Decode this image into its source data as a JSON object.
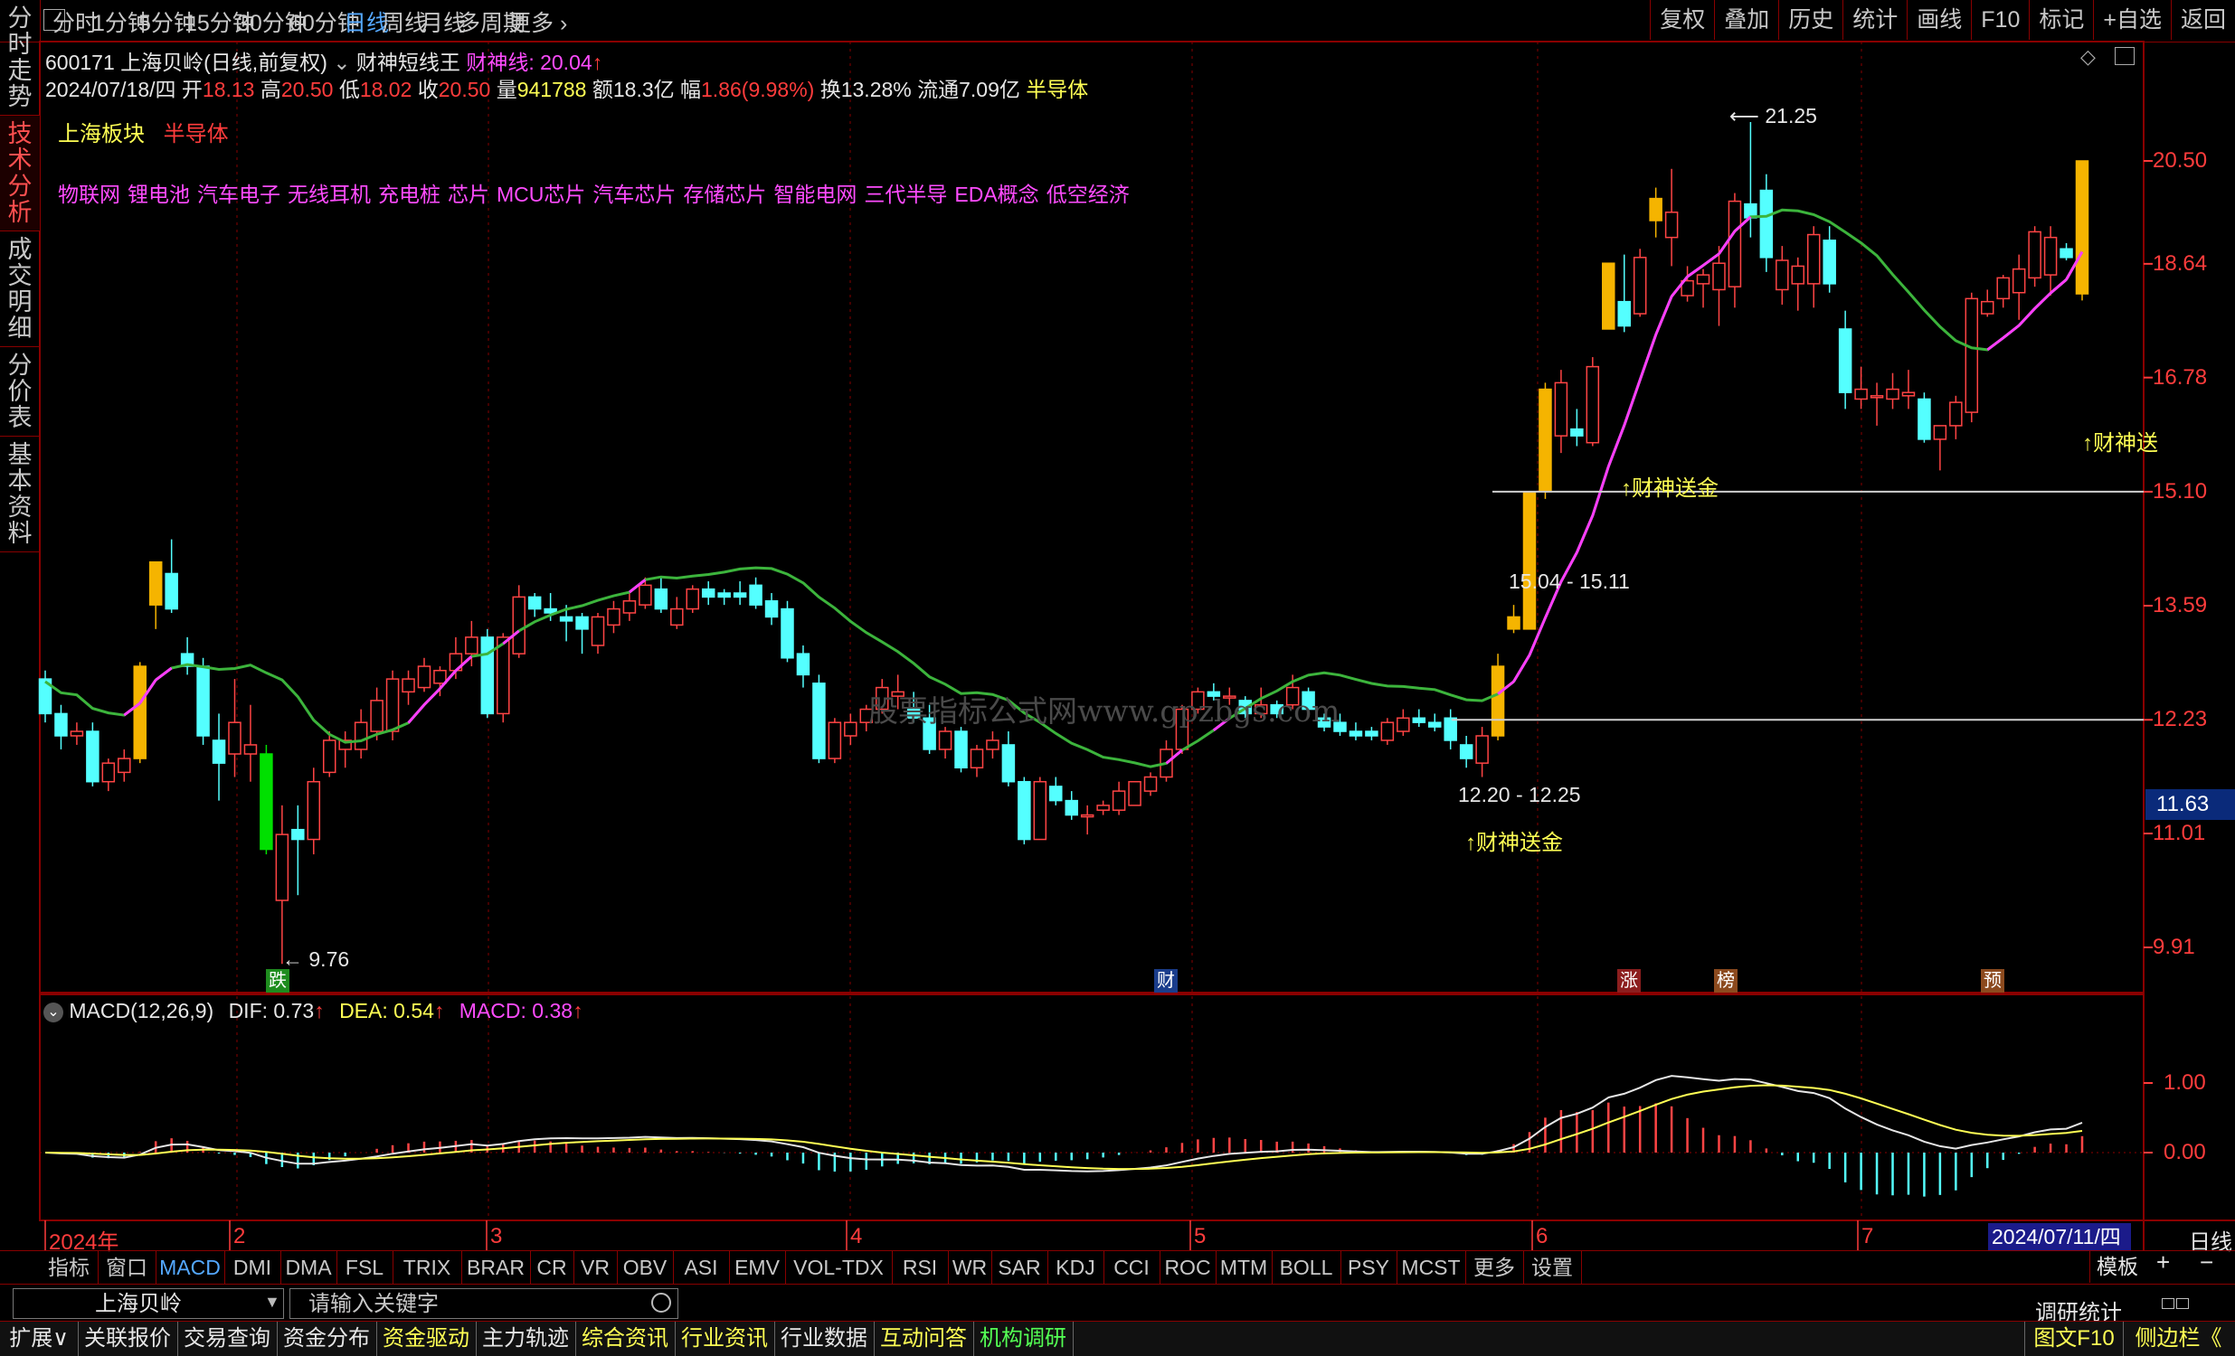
{
  "top_tabs": [
    "分时",
    "1分钟",
    "5分钟",
    "15分钟",
    "30分钟",
    "60分钟",
    "日线",
    "周线",
    "月线",
    "多周期",
    "更多"
  ],
  "active_top_tab": "日线",
  "top_right_buttons": [
    "复权",
    "叠加",
    "历史",
    "统计",
    "画线",
    "F10",
    "标记",
    "+自选",
    "返回"
  ],
  "left_tabs": [
    "分时走势",
    "技术分析",
    "成交明细",
    "分价表",
    "基本资料"
  ],
  "active_left_tab": "技术分析",
  "stock_header": {
    "code_name": "600171 上海贝岭(日线,前复权)",
    "indicator": "财神短线王",
    "line_label": "财神线:",
    "line_value": "20.04",
    "arrow": "↑"
  },
  "quote": {
    "date": "2024/07/18/四",
    "open_label": "开",
    "open": "18.13",
    "high_label": "高",
    "high": "20.50",
    "low_label": "低",
    "low": "18.02",
    "close_label": "收",
    "close": "20.50",
    "vol_label": "量",
    "vol": "941788",
    "amount": "额18.3亿",
    "change_label": "幅",
    "change": "1.86(9.98%)",
    "turnover": "换13.28%",
    "float": "流通7.09亿",
    "sector": "半导体"
  },
  "board": {
    "label": "上海板块",
    "sector": "半导体"
  },
  "concepts": [
    "物联网",
    "锂电池",
    "汽车电子",
    "无线耳机",
    "充电桩",
    "芯片",
    "MCU芯片",
    "汽车芯片",
    "存储芯片",
    "智能电网",
    "三代半导",
    "EDA概念",
    "低空经济"
  ],
  "watermark": "股票指标公式网www.gpzbgs.com",
  "price_ticks": [
    "20.50",
    "18.64",
    "16.78",
    "15.10",
    "13.59",
    "12.23",
    "11.01",
    "9.91"
  ],
  "current_price": "11.63",
  "annotations": {
    "high_label": "21.25",
    "low_label": "9.76",
    "zone_upper": "15.04 - 15.11",
    "zone_lower": "12.20 - 12.25",
    "signal_1": "↑财神送金",
    "signal_2": "↑财神送金",
    "signal_3": "↑财神送"
  },
  "event_markers": [
    {
      "text": "跌",
      "color": "#1e8c1e"
    },
    {
      "text": "财",
      "color": "#1a3d8c"
    },
    {
      "text": "涨",
      "color": "#8c1e1e"
    },
    {
      "text": "榜",
      "color": "#8c4a1e"
    },
    {
      "text": "预",
      "color": "#8c4a1e"
    }
  ],
  "macd_header": {
    "name": "MACD(12,26,9)",
    "dif": "DIF: 0.73",
    "dea": "DEA: 0.54",
    "macd": "MACD: 0.38",
    "arrow": "↑"
  },
  "macd_ticks": [
    "1.00",
    "0.00"
  ],
  "date_axis": [
    "2024年",
    "2",
    "3",
    "4",
    "5",
    "6",
    "7"
  ],
  "current_date": "2024/07/11/四",
  "period_label": "日线",
  "indicator_tabs": [
    "指标",
    "窗口",
    "MACD",
    "DMI",
    "DMA",
    "FSL",
    "TRIX",
    "BRAR",
    "CR",
    "VR",
    "OBV",
    "ASI",
    "EMV",
    "VOL-TDX",
    "RSI",
    "WR",
    "SAR",
    "KDJ",
    "CCI",
    "ROC",
    "MTM",
    "BOLL",
    "PSY",
    "MCST",
    "更多",
    "设置"
  ],
  "active_indicator_tab": "MACD",
  "template_label": "模板",
  "search": {
    "stock_name": "上海贝岭",
    "placeholder": "请输入关键字"
  },
  "research_label": "调研统计",
  "bottom_tabs": [
    "扩展∨",
    "关联报价",
    "交易查询",
    "资金分布",
    "资金驱动",
    "主力轨迹",
    "综合资讯",
    "行业资讯",
    "行业数据",
    "互动问答",
    "机构调研"
  ],
  "bottom_right": [
    "图文F10",
    "侧边栏《"
  ],
  "chart_data": {
    "type": "candlestick",
    "series": [
      {
        "d": "2024-01-02",
        "o": 12.7,
        "h": 12.8,
        "l": 12.2,
        "c": 12.3
      },
      {
        "d": "2024-01-03",
        "o": 12.3,
        "h": 12.4,
        "l": 11.9,
        "c": 12.05
      },
      {
        "d": "2024-01-04",
        "o": 12.05,
        "h": 12.2,
        "l": 11.95,
        "c": 12.1
      },
      {
        "d": "2024-01-05",
        "o": 12.1,
        "h": 12.2,
        "l": 11.5,
        "c": 11.55
      },
      {
        "d": "2024-01-08",
        "o": 11.55,
        "h": 11.8,
        "l": 11.45,
        "c": 11.75
      },
      {
        "d": "2024-01-09",
        "o": 11.65,
        "h": 11.9,
        "l": 11.55,
        "c": 11.8
      },
      {
        "d": "2024-01-10",
        "o": 11.8,
        "h": 12.9,
        "l": 11.75,
        "c": 12.85
      },
      {
        "d": "2024-01-11",
        "o": 13.6,
        "h": 14.15,
        "l": 13.3,
        "c": 14.15
      },
      {
        "d": "2024-01-12",
        "o": 14.0,
        "h": 14.45,
        "l": 13.5,
        "c": 13.55
      },
      {
        "d": "2024-01-15",
        "o": 13.0,
        "h": 13.2,
        "l": 12.75,
        "c": 12.85
      },
      {
        "d": "2024-01-16",
        "o": 12.85,
        "h": 12.95,
        "l": 11.95,
        "c": 12.05
      },
      {
        "d": "2024-01-17",
        "o": 12.0,
        "h": 12.3,
        "l": 11.35,
        "c": 11.75
      },
      {
        "d": "2024-01-18",
        "o": 11.85,
        "h": 12.7,
        "l": 11.6,
        "c": 12.2
      },
      {
        "d": "2024-01-19",
        "o": 11.85,
        "h": 12.4,
        "l": 11.55,
        "c": 11.95
      },
      {
        "d": "2024-01-22",
        "o": 11.85,
        "h": 11.95,
        "l": 10.8,
        "c": 10.85
      },
      {
        "d": "2024-02-05",
        "o": 10.35,
        "h": 11.3,
        "l": 9.76,
        "c": 11.0
      },
      {
        "d": "2024-02-06",
        "o": 11.05,
        "h": 11.3,
        "l": 10.4,
        "c": 10.95
      },
      {
        "d": "2024-02-07",
        "o": 10.95,
        "h": 11.7,
        "l": 10.8,
        "c": 11.55
      },
      {
        "d": "2024-02-08",
        "o": 11.65,
        "h": 12.1,
        "l": 11.6,
        "c": 12.0
      },
      {
        "d": "2024-02-19",
        "o": 11.9,
        "h": 12.1,
        "l": 11.7,
        "c": 12.0
      },
      {
        "d": "2024-02-20",
        "o": 11.9,
        "h": 12.35,
        "l": 11.8,
        "c": 12.2
      },
      {
        "d": "2024-02-21",
        "o": 12.1,
        "h": 12.6,
        "l": 12.0,
        "c": 12.45
      },
      {
        "d": "2024-02-22",
        "o": 12.1,
        "h": 12.8,
        "l": 12.0,
        "c": 12.7
      },
      {
        "d": "2024-02-23",
        "o": 12.55,
        "h": 12.8,
        "l": 12.4,
        "c": 12.7
      },
      {
        "d": "2024-02-26",
        "o": 12.6,
        "h": 12.95,
        "l": 12.55,
        "c": 12.85
      },
      {
        "d": "2024-02-27",
        "o": 12.65,
        "h": 12.85,
        "l": 12.5,
        "c": 12.8
      },
      {
        "d": "2024-02-28",
        "o": 12.8,
        "h": 13.2,
        "l": 12.7,
        "c": 13.0
      },
      {
        "d": "2024-02-29",
        "o": 13.0,
        "h": 13.4,
        "l": 12.85,
        "c": 13.2
      },
      {
        "d": "2024-03-01",
        "o": 13.2,
        "h": 13.3,
        "l": 12.25,
        "c": 12.3
      },
      {
        "d": "2024-03-04",
        "o": 12.3,
        "h": 13.25,
        "l": 12.2,
        "c": 13.2
      },
      {
        "d": "2024-03-05",
        "o": 13.0,
        "h": 13.85,
        "l": 12.95,
        "c": 13.7
      },
      {
        "d": "2024-03-06",
        "o": 13.7,
        "h": 13.75,
        "l": 13.45,
        "c": 13.55
      },
      {
        "d": "2024-03-07",
        "o": 13.55,
        "h": 13.75,
        "l": 13.4,
        "c": 13.5
      },
      {
        "d": "2024-03-08",
        "o": 13.45,
        "h": 13.6,
        "l": 13.15,
        "c": 13.4
      },
      {
        "d": "2024-03-11",
        "o": 13.45,
        "h": 13.5,
        "l": 13.0,
        "c": 13.3
      },
      {
        "d": "2024-03-12",
        "o": 13.1,
        "h": 13.5,
        "l": 13.0,
        "c": 13.45
      },
      {
        "d": "2024-03-13",
        "o": 13.35,
        "h": 13.65,
        "l": 13.25,
        "c": 13.55
      },
      {
        "d": "2024-03-14",
        "o": 13.5,
        "h": 13.75,
        "l": 13.4,
        "c": 13.65
      },
      {
        "d": "2024-03-15",
        "o": 13.6,
        "h": 13.95,
        "l": 13.55,
        "c": 13.85
      },
      {
        "d": "2024-03-18",
        "o": 13.8,
        "h": 13.95,
        "l": 13.5,
        "c": 13.55
      },
      {
        "d": "2024-03-19",
        "o": 13.35,
        "h": 13.7,
        "l": 13.3,
        "c": 13.55
      },
      {
        "d": "2024-03-20",
        "o": 13.55,
        "h": 13.85,
        "l": 13.5,
        "c": 13.8
      },
      {
        "d": "2024-03-21",
        "o": 13.8,
        "h": 13.9,
        "l": 13.6,
        "c": 13.7
      },
      {
        "d": "2024-03-22",
        "o": 13.75,
        "h": 13.8,
        "l": 13.6,
        "c": 13.7
      },
      {
        "d": "2024-03-25",
        "o": 13.75,
        "h": 13.9,
        "l": 13.6,
        "c": 13.7
      },
      {
        "d": "2024-03-26",
        "o": 13.85,
        "h": 13.95,
        "l": 13.55,
        "c": 13.6
      },
      {
        "d": "2024-03-27",
        "o": 13.65,
        "h": 13.75,
        "l": 13.35,
        "c": 13.45
      },
      {
        "d": "2024-03-28",
        "o": 13.55,
        "h": 13.65,
        "l": 12.9,
        "c": 12.95
      },
      {
        "d": "2024-03-29",
        "o": 13.0,
        "h": 13.1,
        "l": 12.6,
        "c": 12.75
      },
      {
        "d": "2024-04-01",
        "o": 12.65,
        "h": 12.75,
        "l": 11.75,
        "c": 11.8
      },
      {
        "d": "2024-04-02",
        "o": 11.8,
        "h": 12.25,
        "l": 11.75,
        "c": 12.2
      },
      {
        "d": "2024-04-03",
        "o": 12.05,
        "h": 12.3,
        "l": 11.95,
        "c": 12.2
      },
      {
        "d": "2024-04-08",
        "o": 12.2,
        "h": 12.4,
        "l": 12.1,
        "c": 12.35
      },
      {
        "d": "2024-04-09",
        "o": 12.35,
        "h": 12.7,
        "l": 12.3,
        "c": 12.6
      },
      {
        "d": "2024-04-10",
        "o": 12.5,
        "h": 12.75,
        "l": 12.35,
        "c": 12.55
      },
      {
        "d": "2024-04-11",
        "o": 12.35,
        "h": 12.55,
        "l": 12.2,
        "c": 12.25
      },
      {
        "d": "2024-04-12",
        "o": 12.25,
        "h": 12.4,
        "l": 11.85,
        "c": 11.9
      },
      {
        "d": "2024-04-15",
        "o": 11.9,
        "h": 12.15,
        "l": 11.8,
        "c": 12.1
      },
      {
        "d": "2024-04-16",
        "o": 12.1,
        "h": 12.15,
        "l": 11.65,
        "c": 11.7
      },
      {
        "d": "2024-04-17",
        "o": 11.7,
        "h": 11.95,
        "l": 11.6,
        "c": 11.9
      },
      {
        "d": "2024-04-18",
        "o": 11.9,
        "h": 12.1,
        "l": 11.8,
        "c": 12.0
      },
      {
        "d": "2024-04-19",
        "o": 11.95,
        "h": 12.1,
        "l": 11.5,
        "c": 11.55
      },
      {
        "d": "2024-04-22",
        "o": 11.55,
        "h": 11.6,
        "l": 10.9,
        "c": 10.95
      },
      {
        "d": "2024-04-23",
        "o": 10.95,
        "h": 11.6,
        "l": 10.95,
        "c": 11.55
      },
      {
        "d": "2024-04-24",
        "o": 11.5,
        "h": 11.6,
        "l": 11.3,
        "c": 11.35
      },
      {
        "d": "2024-04-25",
        "o": 11.35,
        "h": 11.45,
        "l": 11.15,
        "c": 11.2
      },
      {
        "d": "2024-04-26",
        "o": 11.2,
        "h": 11.3,
        "l": 11.0,
        "c": 11.2
      },
      {
        "d": "2024-04-29",
        "o": 11.25,
        "h": 11.35,
        "l": 11.2,
        "c": 11.3
      },
      {
        "d": "2024-04-30",
        "o": 11.25,
        "h": 11.55,
        "l": 11.2,
        "c": 11.45
      },
      {
        "d": "2024-05-06",
        "o": 11.3,
        "h": 11.55,
        "l": 11.3,
        "c": 11.55
      },
      {
        "d": "2024-05-07",
        "o": 11.45,
        "h": 11.65,
        "l": 11.4,
        "c": 11.6
      },
      {
        "d": "2024-05-08",
        "o": 11.6,
        "h": 12.0,
        "l": 11.55,
        "c": 11.9
      },
      {
        "d": "2024-05-09",
        "o": 11.9,
        "h": 12.4,
        "l": 11.85,
        "c": 12.35
      },
      {
        "d": "2024-05-10",
        "o": 12.35,
        "h": 12.6,
        "l": 12.3,
        "c": 12.55
      },
      {
        "d": "2024-05-13",
        "o": 12.55,
        "h": 12.65,
        "l": 12.45,
        "c": 12.5
      },
      {
        "d": "2024-05-14",
        "o": 12.5,
        "h": 12.6,
        "l": 12.4,
        "c": 12.5
      },
      {
        "d": "2024-05-15",
        "o": 12.45,
        "h": 12.5,
        "l": 12.25,
        "c": 12.3
      },
      {
        "d": "2024-05-16",
        "o": 12.3,
        "h": 12.6,
        "l": 12.25,
        "c": 12.4
      },
      {
        "d": "2024-05-17",
        "o": 12.4,
        "h": 12.45,
        "l": 12.25,
        "c": 12.3
      },
      {
        "d": "2024-05-20",
        "o": 12.4,
        "h": 12.75,
        "l": 12.35,
        "c": 12.6
      },
      {
        "d": "2024-05-21",
        "o": 12.55,
        "h": 12.6,
        "l": 12.3,
        "c": 12.35
      },
      {
        "d": "2024-05-22",
        "o": 12.25,
        "h": 12.3,
        "l": 12.1,
        "c": 12.15
      },
      {
        "d": "2024-05-23",
        "o": 12.2,
        "h": 12.3,
        "l": 12.05,
        "c": 12.1
      },
      {
        "d": "2024-05-24",
        "o": 12.1,
        "h": 12.2,
        "l": 12.0,
        "c": 12.05
      },
      {
        "d": "2024-05-27",
        "o": 12.1,
        "h": 12.15,
        "l": 12.0,
        "c": 12.05
      },
      {
        "d": "2024-05-28",
        "o": 12.0,
        "h": 12.25,
        "l": 11.95,
        "c": 12.2
      },
      {
        "d": "2024-05-29",
        "o": 12.1,
        "h": 12.35,
        "l": 12.05,
        "c": 12.25
      },
      {
        "d": "2024-05-30",
        "o": 12.25,
        "h": 12.35,
        "l": 12.15,
        "c": 12.2
      },
      {
        "d": "2024-05-31",
        "o": 12.2,
        "h": 12.3,
        "l": 12.1,
        "c": 12.15
      },
      {
        "d": "2024-06-03",
        "o": 12.25,
        "h": 12.35,
        "l": 11.9,
        "c": 12.0
      },
      {
        "d": "2024-06-04",
        "o": 11.95,
        "h": 12.05,
        "l": 11.7,
        "c": 11.8
      },
      {
        "d": "2024-06-05",
        "o": 11.75,
        "h": 12.15,
        "l": 11.6,
        "c": 12.05
      },
      {
        "d": "2024-06-06",
        "o": 12.05,
        "h": 13.0,
        "l": 12.0,
        "c": 12.85
      },
      {
        "d": "2024-06-07",
        "o": 13.3,
        "h": 13.6,
        "l": 13.25,
        "c": 13.45
      },
      {
        "d": "2024-06-11",
        "o": 13.3,
        "h": 15.1,
        "l": 13.3,
        "c": 15.1
      },
      {
        "d": "2024-06-12",
        "o": 15.1,
        "h": 16.7,
        "l": 15.0,
        "c": 16.6
      },
      {
        "d": "2024-06-13",
        "o": 15.9,
        "h": 16.9,
        "l": 15.65,
        "c": 16.7
      },
      {
        "d": "2024-06-14",
        "o": 16.0,
        "h": 16.3,
        "l": 15.75,
        "c": 15.9
      },
      {
        "d": "2024-06-17",
        "o": 15.8,
        "h": 17.1,
        "l": 15.75,
        "c": 16.95
      },
      {
        "d": "2024-06-18",
        "o": 17.55,
        "h": 18.65,
        "l": 17.55,
        "c": 18.65
      },
      {
        "d": "2024-06-19",
        "o": 18.0,
        "h": 18.8,
        "l": 17.5,
        "c": 17.6
      },
      {
        "d": "2024-06-20",
        "o": 17.8,
        "h": 18.9,
        "l": 17.75,
        "c": 18.75
      },
      {
        "d": "2024-06-21",
        "o": 19.4,
        "h": 20.0,
        "l": 19.1,
        "c": 19.8
      },
      {
        "d": "2024-06-24",
        "o": 19.1,
        "h": 20.35,
        "l": 18.6,
        "c": 19.55
      },
      {
        "d": "2024-06-25",
        "o": 18.1,
        "h": 18.6,
        "l": 18.0,
        "c": 18.35
      },
      {
        "d": "2024-06-26",
        "o": 18.3,
        "h": 18.55,
        "l": 17.9,
        "c": 18.45
      },
      {
        "d": "2024-06-27",
        "o": 18.2,
        "h": 18.95,
        "l": 17.6,
        "c": 18.65
      },
      {
        "d": "2024-06-28",
        "o": 18.25,
        "h": 19.9,
        "l": 17.9,
        "c": 19.75
      },
      {
        "d": "2024-07-01",
        "o": 19.7,
        "h": 21.25,
        "l": 19.1,
        "c": 19.45
      },
      {
        "d": "2024-07-02",
        "o": 19.95,
        "h": 20.25,
        "l": 18.5,
        "c": 18.75
      },
      {
        "d": "2024-07-03",
        "o": 18.2,
        "h": 18.95,
        "l": 17.95,
        "c": 18.7
      },
      {
        "d": "2024-07-04",
        "o": 18.3,
        "h": 18.75,
        "l": 17.85,
        "c": 18.6
      },
      {
        "d": "2024-07-05",
        "o": 18.3,
        "h": 19.3,
        "l": 17.9,
        "c": 19.15
      },
      {
        "d": "2024-07-08",
        "o": 19.05,
        "h": 19.3,
        "l": 18.15,
        "c": 18.3
      },
      {
        "d": "2024-07-09",
        "o": 17.55,
        "h": 17.85,
        "l": 16.3,
        "c": 16.55
      },
      {
        "d": "2024-07-10",
        "o": 16.45,
        "h": 16.95,
        "l": 16.3,
        "c": 16.6
      },
      {
        "d": "2024-07-11",
        "o": 16.5,
        "h": 16.7,
        "l": 16.05,
        "c": 16.5
      },
      {
        "d": "2024-07-12",
        "o": 16.45,
        "h": 16.85,
        "l": 16.3,
        "c": 16.6
      },
      {
        "d": "2024-07-15",
        "o": 16.5,
        "h": 16.9,
        "l": 16.3,
        "c": 16.55
      },
      {
        "d": "2024-07-16",
        "o": 16.45,
        "h": 16.55,
        "l": 15.8,
        "c": 15.85
      },
      {
        "d": "2024-07-17",
        "o": 15.85,
        "h": 16.0,
        "l": 15.4,
        "c": 16.05
      },
      {
        "d": "2024-07-18",
        "o": 16.05,
        "h": 16.5,
        "l": 15.85,
        "c": 16.4
      },
      {
        "d": "2024-07-19",
        "o": 16.25,
        "h": 18.15,
        "l": 16.1,
        "c": 18.05
      },
      {
        "d": "2024-07-22",
        "o": 17.8,
        "h": 18.2,
        "l": 17.75,
        "c": 18.0
      },
      {
        "d": "2024-07-23",
        "o": 18.05,
        "h": 18.45,
        "l": 17.9,
        "c": 18.4
      },
      {
        "d": "2024-07-24",
        "o": 18.15,
        "h": 18.8,
        "l": 17.7,
        "c": 18.55
      },
      {
        "d": "2024-07-25",
        "o": 18.4,
        "h": 19.3,
        "l": 18.25,
        "c": 19.2
      },
      {
        "d": "2024-07-26",
        "o": 18.45,
        "h": 19.3,
        "l": 18.1,
        "c": 19.1
      },
      {
        "d": "2024-07-29",
        "o": 18.9,
        "h": 19.0,
        "l": 18.7,
        "c": 18.75
      },
      {
        "d": "2024-07-30",
        "o": 18.13,
        "h": 20.5,
        "l": 18.02,
        "c": 20.5
      }
    ],
    "signal_days": [
      "2024-01-10",
      "2024-01-11",
      "2024-06-06",
      "2024-06-07",
      "2024-06-11",
      "2024-06-12",
      "2024-06-18",
      "2024-06-21",
      "2024-07-30"
    ],
    "limit_down_days": [
      "2024-01-22"
    ],
    "ylim": [
      9.5,
      21.5
    ]
  }
}
